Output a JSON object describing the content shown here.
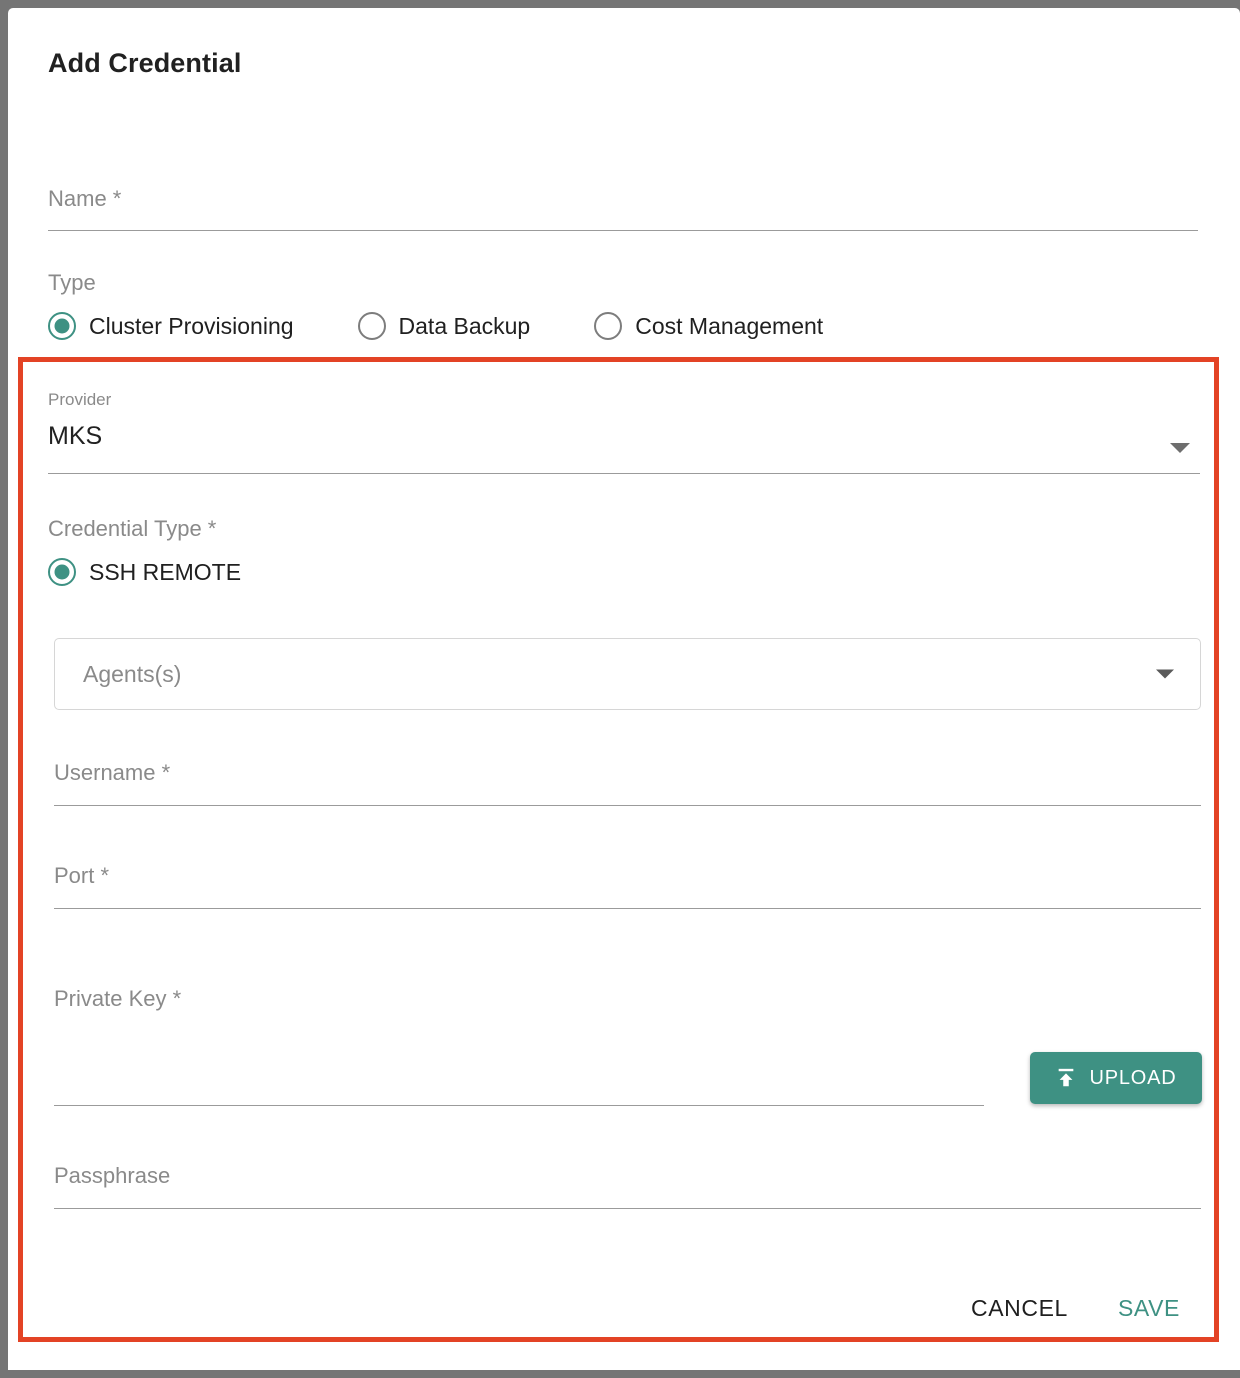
{
  "dialog": {
    "title": "Add Credential"
  },
  "name_field": {
    "label": "Name *",
    "value": "",
    "placeholder": "Name *"
  },
  "type_group": {
    "label": "Type",
    "options": [
      {
        "label": "Cluster Provisioning",
        "selected": true
      },
      {
        "label": "Data Backup",
        "selected": false
      },
      {
        "label": "Cost Management",
        "selected": false
      }
    ]
  },
  "provider_field": {
    "label": "Provider",
    "value": "MKS",
    "icon": "chevron-down-icon"
  },
  "credential_type_group": {
    "label": "Credential Type *",
    "options": [
      {
        "label": "SSH REMOTE",
        "selected": true
      }
    ]
  },
  "agents_select": {
    "placeholder": "Agents(s)",
    "value": "",
    "icon": "chevron-down-icon"
  },
  "username_field": {
    "label": "Username *",
    "value": "",
    "placeholder": "Username *"
  },
  "port_field": {
    "label": "Port *",
    "value": "",
    "placeholder": "Port *"
  },
  "private_key_field": {
    "label": "Private Key *",
    "value": "",
    "placeholder": "Private Key *"
  },
  "upload_button": {
    "label": "UPLOAD",
    "icon": "upload-icon"
  },
  "passphrase_field": {
    "label": "Passphrase",
    "value": "",
    "placeholder": "Passphrase"
  },
  "footer": {
    "cancel_label": "CANCEL",
    "save_label": "SAVE"
  },
  "colors": {
    "accent_teal": "#3E9183",
    "highlight_red": "#E34325",
    "backdrop_gray": "#757575",
    "label_gray": "#8a8a8a",
    "text_dark": "#212121"
  }
}
